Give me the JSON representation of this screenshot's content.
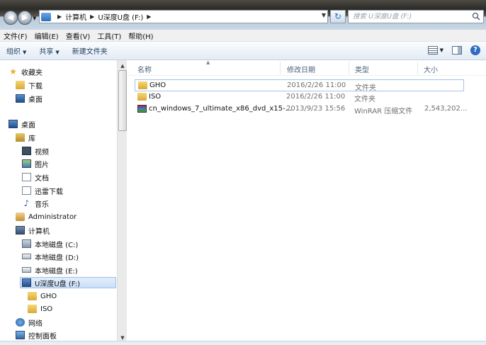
{
  "address": {
    "segments": [
      "计算机",
      "U深度U盘 (F:)"
    ]
  },
  "search": {
    "placeholder": "搜索 U深度U盘 (F:)"
  },
  "menu": [
    "文件(F)",
    "编辑(E)",
    "查看(V)",
    "工具(T)",
    "帮助(H)"
  ],
  "toolbar": {
    "organize": "组织",
    "share": "共享",
    "new_folder": "新建文件夹"
  },
  "nav": {
    "favorites": "收藏夹",
    "downloads": "下载",
    "desktop_fav": "桌面",
    "desktop": "桌面",
    "library": "库",
    "videos": "视频",
    "pictures": "图片",
    "documents": "文档",
    "thunder": "迅雷下载",
    "music": "音乐",
    "admin": "Administrator",
    "computer": "计算机",
    "drive_c": "本地磁盘 (C:)",
    "drive_d": "本地磁盘 (D:)",
    "drive_e": "本地磁盘 (E:)",
    "drive_f": "U深度U盘 (F:)",
    "sub_gho": "GHO",
    "sub_iso": "ISO",
    "network": "网络",
    "control_panel": "控制面板"
  },
  "columns": {
    "name": "名称",
    "modified": "修改日期",
    "type": "类型",
    "size": "大小"
  },
  "files": [
    {
      "name": "GHO",
      "modified": "2016/2/26 11:00",
      "type": "文件夹",
      "size": "",
      "icon": "folder-icon"
    },
    {
      "name": "ISO",
      "modified": "2016/2/26 11:00",
      "type": "文件夹",
      "size": "",
      "icon": "folder-icon"
    },
    {
      "name": "cn_windows_7_ultimate_x86_dvd_x15-...",
      "modified": "2013/9/23 15:56",
      "type": "WinRAR 压缩文件",
      "size": "2,543,202...",
      "icon": "winrar-icon"
    }
  ]
}
